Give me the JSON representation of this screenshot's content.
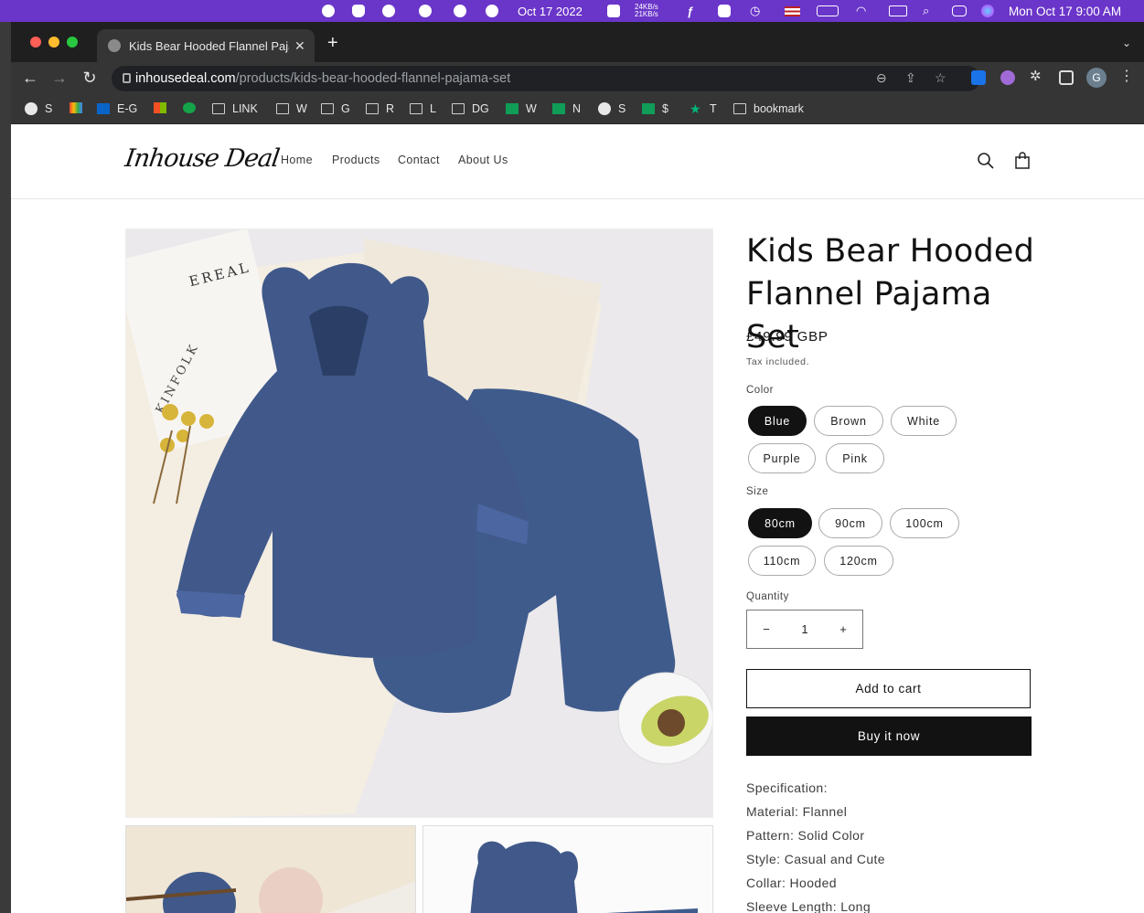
{
  "menubar": {
    "date_short": "Oct 17 2022",
    "net_up": "24KB/s",
    "net_down": "21KB/s",
    "clock": "Mon Oct 17  9:00 AM"
  },
  "browser": {
    "tab_title": "Kids Bear Hooded Flannel Pajama Set",
    "url_host": "inhousedeal.com",
    "url_path": "/products/kids-bear-hooded-flannel-pajama-set",
    "profile_initial": "G",
    "bookmarks": [
      "S",
      "",
      "E-G",
      "",
      "",
      "LINK",
      "W",
      "G",
      "R",
      "L",
      "DG",
      "W",
      "N",
      "S",
      "$",
      "T",
      "bookmark"
    ]
  },
  "store": {
    "logo": "Inhouse Deal",
    "nav": [
      "Home",
      "Products",
      "Contact",
      "About Us"
    ]
  },
  "product": {
    "title": "Kids Bear Hooded Flannel Pajama Set",
    "price": "£49.99 GBP",
    "tax_note": "Tax included.",
    "color_label": "Color",
    "colors": [
      "Blue",
      "Brown",
      "White",
      "Purple",
      "Pink"
    ],
    "selected_color": "Blue",
    "size_label": "Size",
    "sizes": [
      "80cm",
      "90cm",
      "100cm",
      "110cm",
      "120cm"
    ],
    "selected_size": "80cm",
    "quantity_label": "Quantity",
    "quantity": "1",
    "minus": "−",
    "plus": "+",
    "add_to_cart": "Add to cart",
    "buy_now": "Buy it now",
    "specs": [
      "Specification:",
      "Material: Flannel",
      "Pattern: Solid Color",
      "Style: Casual and Cute",
      "Collar: Hooded",
      "Sleeve Length: Long"
    ],
    "image_texts": {
      "card_brand": "EREAL",
      "book_title": "KINFOLK"
    }
  },
  "colors": {
    "menubar": "#6a35c9",
    "selected_pill": "#121212",
    "garment": "#3f5b8c"
  }
}
